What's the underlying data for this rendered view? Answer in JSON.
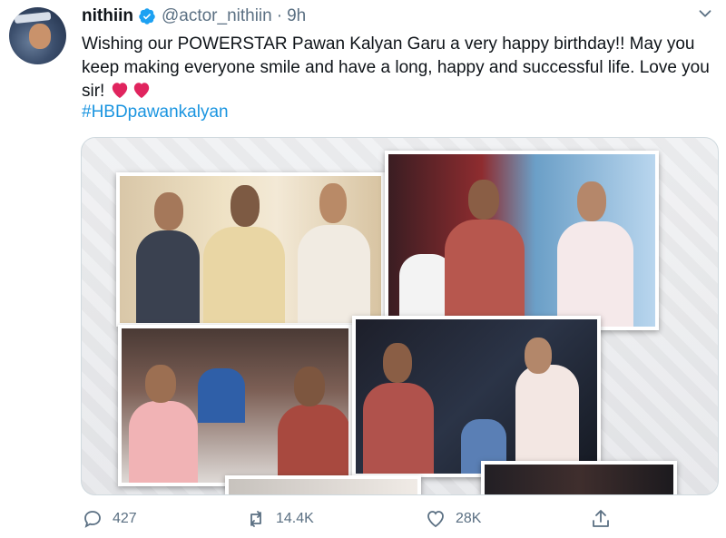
{
  "tweet": {
    "display_name": "nithiin",
    "handle": "@actor_nithiin",
    "separator": "·",
    "time": "9h",
    "text": "Wishing our POWERSTAR Pawan Kalyan Garu a very happy birthday!! May you keep making everyone smile and have a long, happy and successful life. Love you sir!",
    "hashtag": "#HBDpawankalyan",
    "icons": {
      "verified": "verified-badge-icon",
      "more": "chevron-down-icon",
      "hearts": "red-heart-icon"
    }
  },
  "actions": {
    "reply_count": "427",
    "retweet_count": "14.4K",
    "like_count": "28K",
    "icons": [
      "reply-icon",
      "retweet-icon",
      "like-icon",
      "share-icon"
    ]
  },
  "colors": {
    "link": "#1b95e0",
    "muted": "#5b7083",
    "verified": "#1da1f2",
    "heart": "#e0245e"
  }
}
